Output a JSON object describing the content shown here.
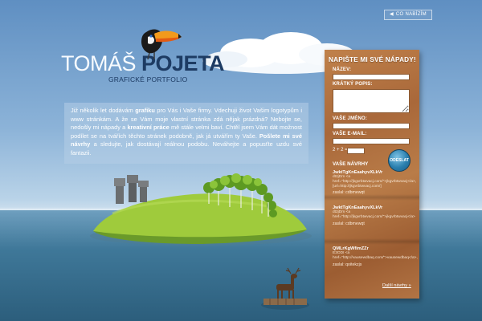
{
  "header": {
    "corner_link": "CO NABÍZÍM",
    "logo_first": "TOMÁŠ",
    "logo_last": "POJETA",
    "logo_subtitle": "GRAFICKÉ PORTFOLIO"
  },
  "intro": {
    "p1": "Již několik let dodávám ",
    "b1": "grafiku",
    "p2": " pro Vás i Vaše firmy. Vdechuji život Vašim logotypům i www stránkám. A že se Vám moje vlastní stránka zdá nějak prázdná? Nebojte se, nedošly mi nápady a ",
    "b2": "kreativní práce",
    "p3": " mě stále velmi baví. Chtěl jsem Vám dát možnost podílet se na tvářích těchto stránek podobně, jak já utvářím ty Vaše. ",
    "b3": "Pošlete mi své návrhy",
    "p4": " a sledujte, jak dostávají reálnou podobu. Neváhejte a popusťte uzdu své fantazii."
  },
  "form": {
    "title": "NAPIŠTE MI SVÉ NÁPADY!",
    "name_label": "NÁZEV:",
    "desc_label": "KRÁTKÝ POPIS:",
    "yourname_label": "VAŠE JMÉNO:",
    "email_label": "VAŠE E-MAIL:",
    "captcha_text": "2 + 2 =",
    "send_label": "ODESLAT"
  },
  "proposals": {
    "title": "VAŠE NÁVRHY",
    "items": [
      {
        "heading": "JwktTgKnEaahyvXLkVr",
        "body": "dt2jDm <a href=\"http://jkgvrbtwvacj.com/\">jkgvrbtwvacj</a>, [url=http://jkgvrbtwvacj.com/]",
        "submitted": "zaslal: cdbmewqt"
      },
      {
        "heading": "JwktTgKnEaahyvXLkVr",
        "body": "dt2jDm <a href=\"http://jkgvrbtwvacj.com/\">jkgvrbtwvacj</a>",
        "submitted": "zaslal: cdbmewqt"
      },
      {
        "heading": "QMLrKgWfimZZr",
        "body": "E3ODI <a href=\"http://vausewdbaq.com/\">vausewdbaq</a>,",
        "submitted": "zaslal: qoitekzjs"
      }
    ],
    "more_link": "Další návrhy »"
  },
  "colors": {
    "sky": "#8cb3d8",
    "sea": "#2c5e7c",
    "panel_wood": "#b27444",
    "logo_dark": "#1d3b63",
    "send_button": "#2a7fae"
  }
}
